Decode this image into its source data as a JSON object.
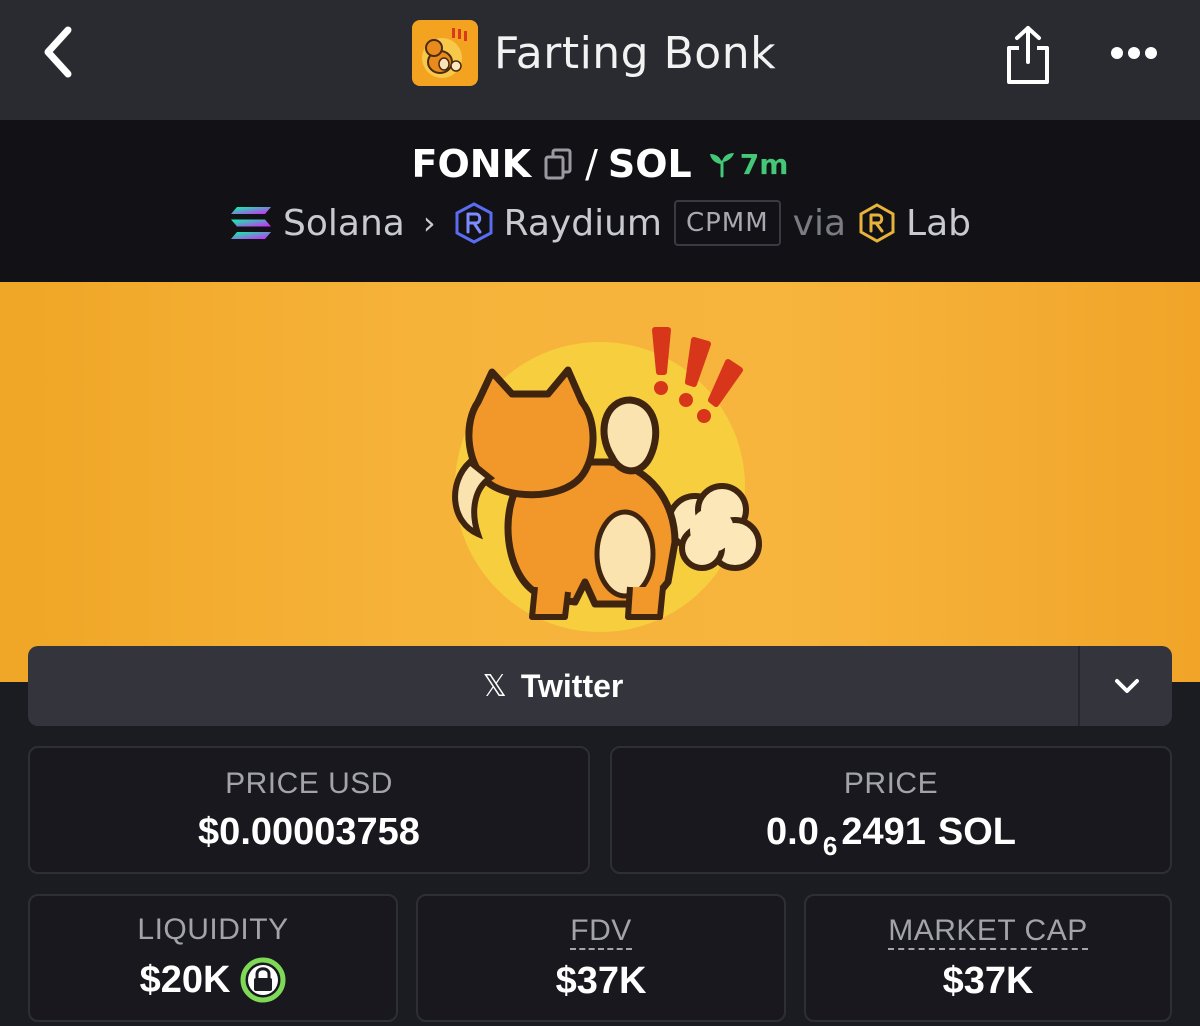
{
  "nav": {
    "title": "Farting Bonk",
    "back_icon": "chevron-left-icon",
    "share_icon": "share-icon",
    "more_icon": "more-horizontal-icon"
  },
  "pair": {
    "base": "FONK",
    "separator": "/",
    "quote": "SOL",
    "age": "7m",
    "chain": "Solana",
    "dex": "Raydium",
    "pool_type": "CPMM",
    "via_label": "via",
    "launchpad": "Lab"
  },
  "social": {
    "label": "Twitter"
  },
  "stats": {
    "price_usd": {
      "label": "PRICE USD",
      "value": "$0.00003758"
    },
    "price_native": {
      "label": "PRICE",
      "prefix": "0.0",
      "zeros": "6",
      "digits": "2491",
      "unit": "SOL"
    },
    "liquidity": {
      "label": "LIQUIDITY",
      "value": "$20K"
    },
    "fdv": {
      "label": "FDV",
      "value": "$37K"
    },
    "market_cap": {
      "label": "MARKET CAP",
      "value": "$37K"
    }
  },
  "colors": {
    "accent_green": "#44c777",
    "banner_orange": "#f4a320",
    "lock_green": "#7ed957"
  }
}
